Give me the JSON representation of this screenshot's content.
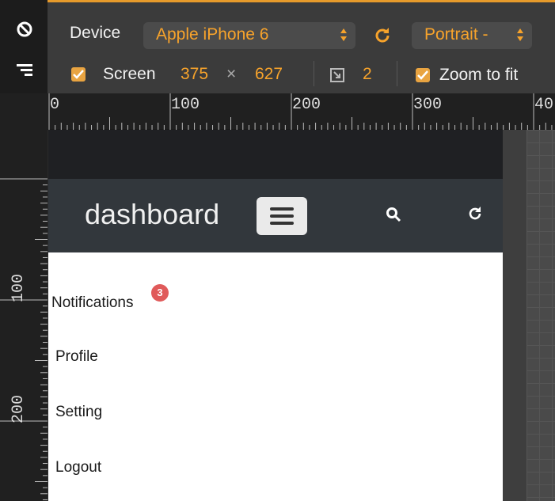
{
  "toolbar": {
    "device_label": "Device",
    "device_value": "Apple iPhone 6",
    "orientation_value": "Portrait -",
    "screen_label": "Screen",
    "screen_width": "375",
    "screen_x": "×",
    "screen_height": "627",
    "dpr_value": "2",
    "zoom_to_fit_label": "Zoom to fit",
    "screen_checked": true,
    "zoom_checked": true
  },
  "ruler": {
    "h_labels": [
      "0",
      "100",
      "200",
      "300",
      "40"
    ],
    "v_labels": [
      "100",
      "200"
    ]
  },
  "app": {
    "brand": "dashboard",
    "menu": [
      "Notifications",
      "Profile",
      "Setting",
      "Logout"
    ],
    "notification_count": "3"
  },
  "colors": {
    "accent": "#f7a32b",
    "navbar": "#32373c",
    "badge": "#e05a5a"
  }
}
